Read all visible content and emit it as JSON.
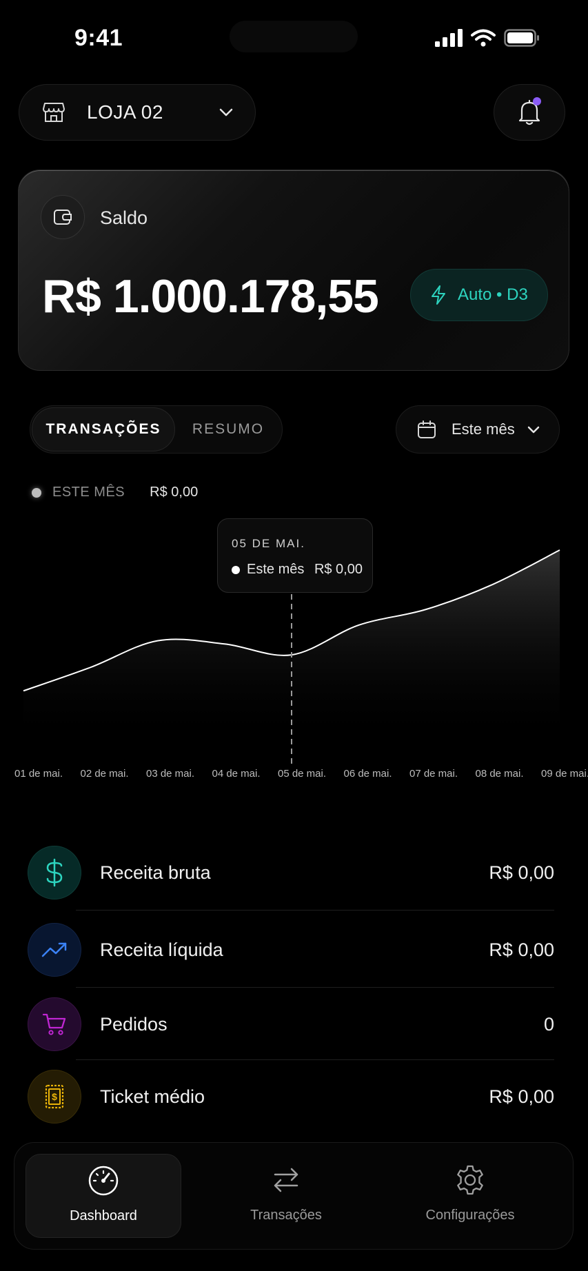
{
  "status_bar": {
    "time": "9:41"
  },
  "header": {
    "store_name": "LOJA 02"
  },
  "balance": {
    "label": "Saldo",
    "value": "R$ 1.000.178,55",
    "payout_badge": "Auto • D3",
    "accent": "#2dd4bf"
  },
  "tabs": [
    {
      "label": "TRANSAÇÕES",
      "active": true
    },
    {
      "label": "RESUMO",
      "active": false
    }
  ],
  "period": {
    "selected": "Este mês"
  },
  "legend": {
    "label": "ESTE MÊS",
    "value": "R$ 0,00"
  },
  "tooltip": {
    "date": "05 DE MAI.",
    "series": "Este mês",
    "value": "R$ 0,00"
  },
  "chart_data": {
    "type": "area",
    "x": [
      "01 de mai.",
      "02 de mai.",
      "03 de mai.",
      "04 de mai.",
      "05 de mai.",
      "06 de mai.",
      "07 de mai.",
      "08 de mai.",
      "09 de mai."
    ],
    "series": [
      {
        "values": [
          0.1,
          0.25,
          0.42,
          0.4,
          0.33,
          0.52,
          0.62,
          0.78,
          1.0
        ]
      }
    ],
    "highlight_index": 4,
    "grid": false
  },
  "metrics": [
    {
      "label": "Receita bruta",
      "value": "R$ 0,00",
      "icon": "dollar-icon",
      "color": "#2dd4bf"
    },
    {
      "label": "Receita líquida",
      "value": "R$ 0,00",
      "icon": "trending-up-icon",
      "color": "#3b82f6"
    },
    {
      "label": "Pedidos",
      "value": "0",
      "icon": "cart-icon",
      "color": "#c026d3"
    },
    {
      "label": "Ticket médio",
      "value": "R$ 0,00",
      "icon": "ticket-icon",
      "color": "#eab308"
    }
  ],
  "nav": [
    {
      "label": "Dashboard",
      "icon": "gauge-icon",
      "active": true
    },
    {
      "label": "Transações",
      "icon": "arrows-icon",
      "active": false
    },
    {
      "label": "Configurações",
      "icon": "gear-icon",
      "active": false
    }
  ]
}
